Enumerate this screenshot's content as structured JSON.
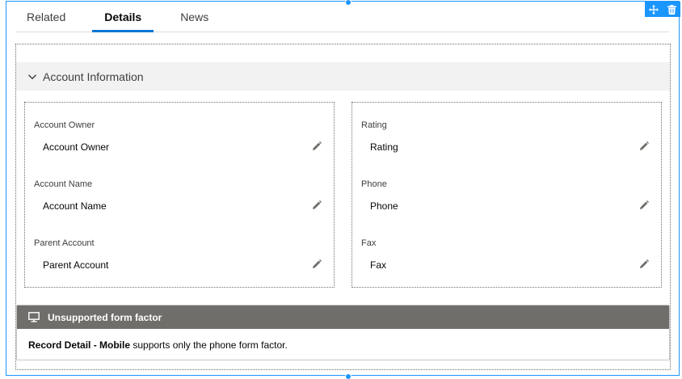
{
  "tabs": [
    {
      "label": "Related",
      "active": false
    },
    {
      "label": "Details",
      "active": true
    },
    {
      "label": "News",
      "active": false
    }
  ],
  "toolbar": {
    "move_icon": "move-icon",
    "delete_icon": "trash-icon",
    "accent": "#1b96ff"
  },
  "section": {
    "title": "Account Information",
    "expanded": true
  },
  "left_fields": [
    {
      "label": "Account Owner",
      "value": "Account Owner"
    },
    {
      "label": "Account Name",
      "value": "Account Name"
    },
    {
      "label": "Parent Account",
      "value": "Parent Account"
    }
  ],
  "right_fields": [
    {
      "label": "Rating",
      "value": "Rating"
    },
    {
      "label": "Phone",
      "value": "Phone"
    },
    {
      "label": "Fax",
      "value": "Fax"
    }
  ],
  "banner": {
    "title": "Unsupported form factor",
    "component_name": "Record Detail - Mobile",
    "message": " supports only the phone form factor.",
    "header_color": "#706e6b"
  }
}
